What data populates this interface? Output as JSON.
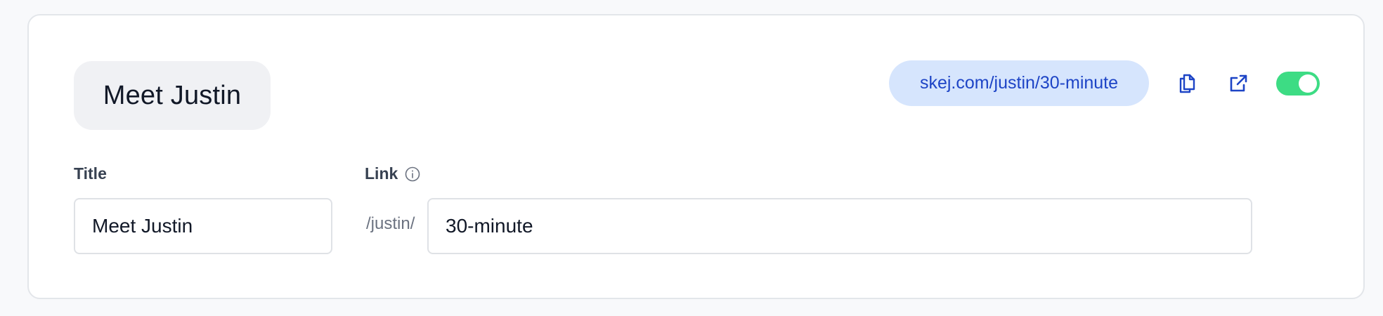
{
  "header": {
    "name": "Meet Justin",
    "booking_url": "skej.com/justin/30-minute",
    "enabled": true
  },
  "icons": {
    "copy": "copy-icon",
    "external": "external-link-icon",
    "info": "info-icon"
  },
  "form": {
    "title_label": "Title",
    "title_value": "Meet Justin",
    "link_label": "Link",
    "link_prefix": "/justin/",
    "link_value": "30-minute"
  },
  "colors": {
    "accent": "#1d44c6",
    "url_pill_bg": "#d6e5fd",
    "toggle_on": "#3ddc84"
  }
}
